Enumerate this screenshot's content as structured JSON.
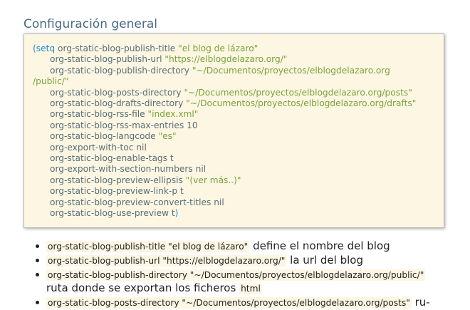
{
  "section_heading": "Configuración general",
  "code": {
    "open_paren": "(",
    "keyword": "setq",
    "close_paren": ")",
    "lines": [
      {
        "var": "org-static-blog-publish-title",
        "value": "\"el blog de lázaro\""
      },
      {
        "var": "org-static-blog-publish-url",
        "value": "\"https://elblogdelazaro.org/\""
      },
      {
        "var": "org-static-blog-publish-directory",
        "value": "\"~/Documentos/proyectos/elblogdelazaro.org",
        "value_wrap": "/public/\""
      },
      {
        "var": "org-static-blog-posts-directory",
        "value": "\"~/Documentos/proyectos/elblogdelazaro.org/posts\""
      },
      {
        "var": "org-static-blog-drafts-directory",
        "value": "\"~/Documentos/proyectos/elblogdelazaro.org/drafts\""
      },
      {
        "var": "org-static-blog-rss-file",
        "value": "\"index.xml\""
      },
      {
        "var": "org-static-blog-rss-max-entries",
        "value": "10"
      },
      {
        "var": "org-static-blog-langcode",
        "value": "\"es\""
      },
      {
        "var": "org-export-with-toc",
        "value": "nil"
      },
      {
        "var": "org-static-blog-enable-tags",
        "value": "t"
      },
      {
        "var": "org-export-with-section-numbers",
        "value": "nil"
      },
      {
        "var": "org-static-blog-preview-ellipsis",
        "value": "\"(ver más..)\""
      },
      {
        "var": "org-static-blog-preview-link-p",
        "value": "t"
      },
      {
        "var": "org-static-blog-preview-convert-titles",
        "value": "nil"
      },
      {
        "var": "org-static-blog-use-preview",
        "value": "t"
      }
    ]
  },
  "bullets": [
    {
      "code": "org-static-blog-publish-title \"el blog de lázaro\"",
      "text": " define el nombre del blog"
    },
    {
      "code": "org-static-blog-publish-url \"https://elblogdelazaro.org/\"",
      "text": " la url del blog"
    },
    {
      "code": "org-static-blog-publish-directory \"~/Documentos/proyectos/elblogdelazaro.org/public/\"",
      "text_line2": "ruta donde se exportan los ficheros ",
      "code2": "html"
    },
    {
      "code": "org-static-blog-posts-directory \"~/Documentos/proyectos/elblogdelazaro.org/posts\"",
      "text": " ru-"
    }
  ]
}
